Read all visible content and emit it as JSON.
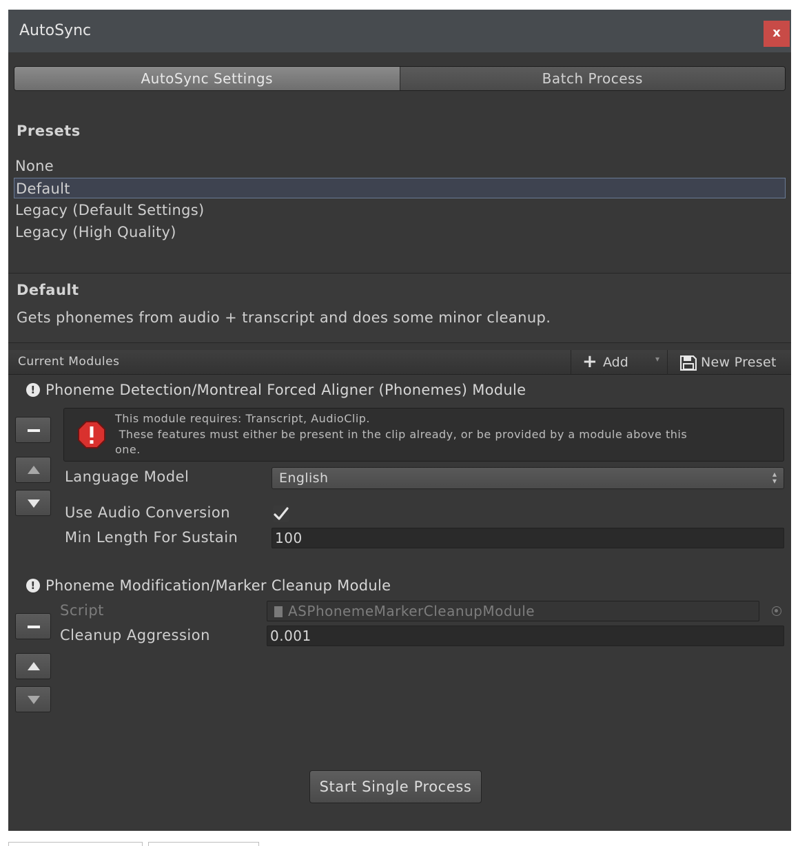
{
  "window": {
    "title": "AutoSync",
    "close_label": "x"
  },
  "tabs": [
    {
      "label": "AutoSync Settings",
      "active": true
    },
    {
      "label": "Batch Process",
      "active": false
    }
  ],
  "presets": {
    "heading": "Presets",
    "items": [
      "None",
      "Default",
      "Legacy (Default Settings)",
      "Legacy (High Quality)"
    ],
    "selected": "Default"
  },
  "description": {
    "title": "Default",
    "text": "Gets phonemes from audio + transcript and does some minor cleanup."
  },
  "modules_bar": {
    "label": "Current Modules",
    "add_label": "Add",
    "new_preset_label": "New Preset"
  },
  "module1": {
    "title": "Phoneme Detection/Montreal Forced Aligner (Phonemes) Module",
    "error_line1": "This module requires: Transcript, AudioClip.",
    "error_line2": " These features must either be present in the clip already, or be provided by a module above this",
    "error_line3": "one.",
    "language_label": "Language Model",
    "language_value": "English",
    "audio_conversion_label": "Use Audio Conversion",
    "audio_conversion_checked": true,
    "min_length_label": "Min Length For Sustain",
    "min_length_value": "100"
  },
  "module2": {
    "title": "Phoneme Modification/Marker Cleanup Module",
    "script_label": "Script",
    "script_value": "ASPhonemeMarkerCleanupModule",
    "aggression_label": "Cleanup Aggression",
    "aggression_value": "0.001"
  },
  "footer": {
    "start_label": "Start Single Process"
  },
  "colors": {
    "window_bg": "#383838",
    "titlebar_bg": "#474b4f",
    "close_bg": "#c84b47",
    "error_red": "#d9312e",
    "selection_border": "#6a7b96"
  }
}
